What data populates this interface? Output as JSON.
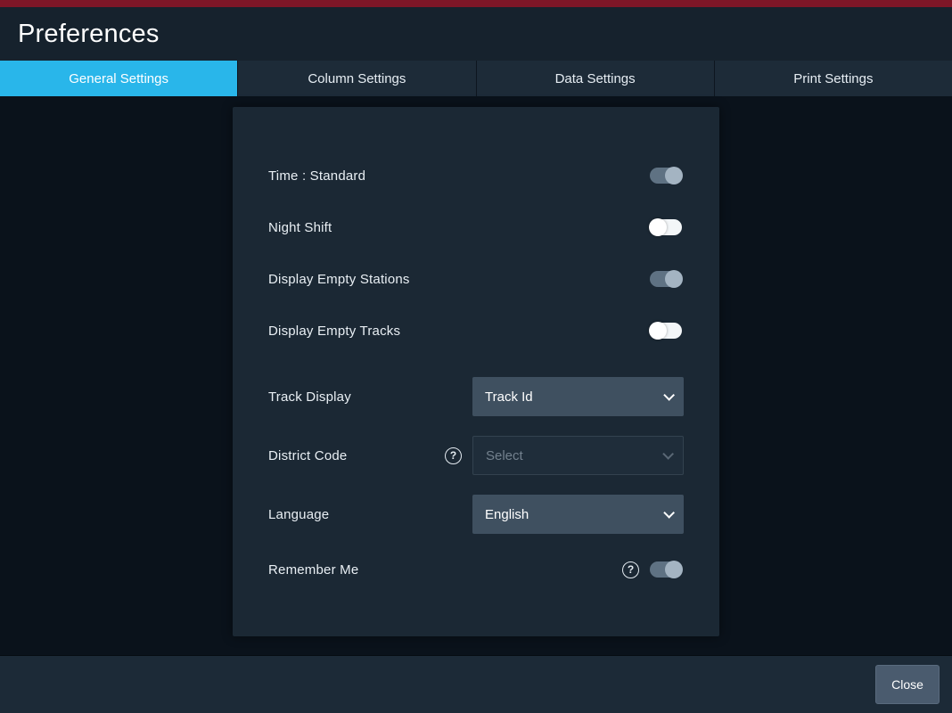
{
  "window": {
    "title": "Preferences",
    "accent_color": "#29b6ea",
    "top_strip_color": "#7e1627"
  },
  "tabs": [
    {
      "label": "General Settings",
      "active": true
    },
    {
      "label": "Column Settings",
      "active": false
    },
    {
      "label": "Data Settings",
      "active": false
    },
    {
      "label": "Print Settings",
      "active": false
    }
  ],
  "rows": [
    {
      "type": "toggle",
      "label": "Time : Standard",
      "on": true
    },
    {
      "type": "toggle",
      "label": "Night Shift",
      "on": false
    },
    {
      "type": "toggle",
      "label": "Display Empty Stations",
      "on": true
    },
    {
      "type": "toggle",
      "label": "Display Empty Tracks",
      "on": false
    },
    {
      "type": "select",
      "label": "Track Display",
      "value": "Track Id",
      "disabled": false
    },
    {
      "type": "select",
      "label": "District Code",
      "value": "Select",
      "disabled": true,
      "help": true
    },
    {
      "type": "select",
      "label": "Language",
      "value": "English",
      "disabled": false
    },
    {
      "type": "toggle",
      "label": "Remember Me",
      "on": true,
      "help": true
    }
  ],
  "footer": {
    "close_label": "Close"
  }
}
